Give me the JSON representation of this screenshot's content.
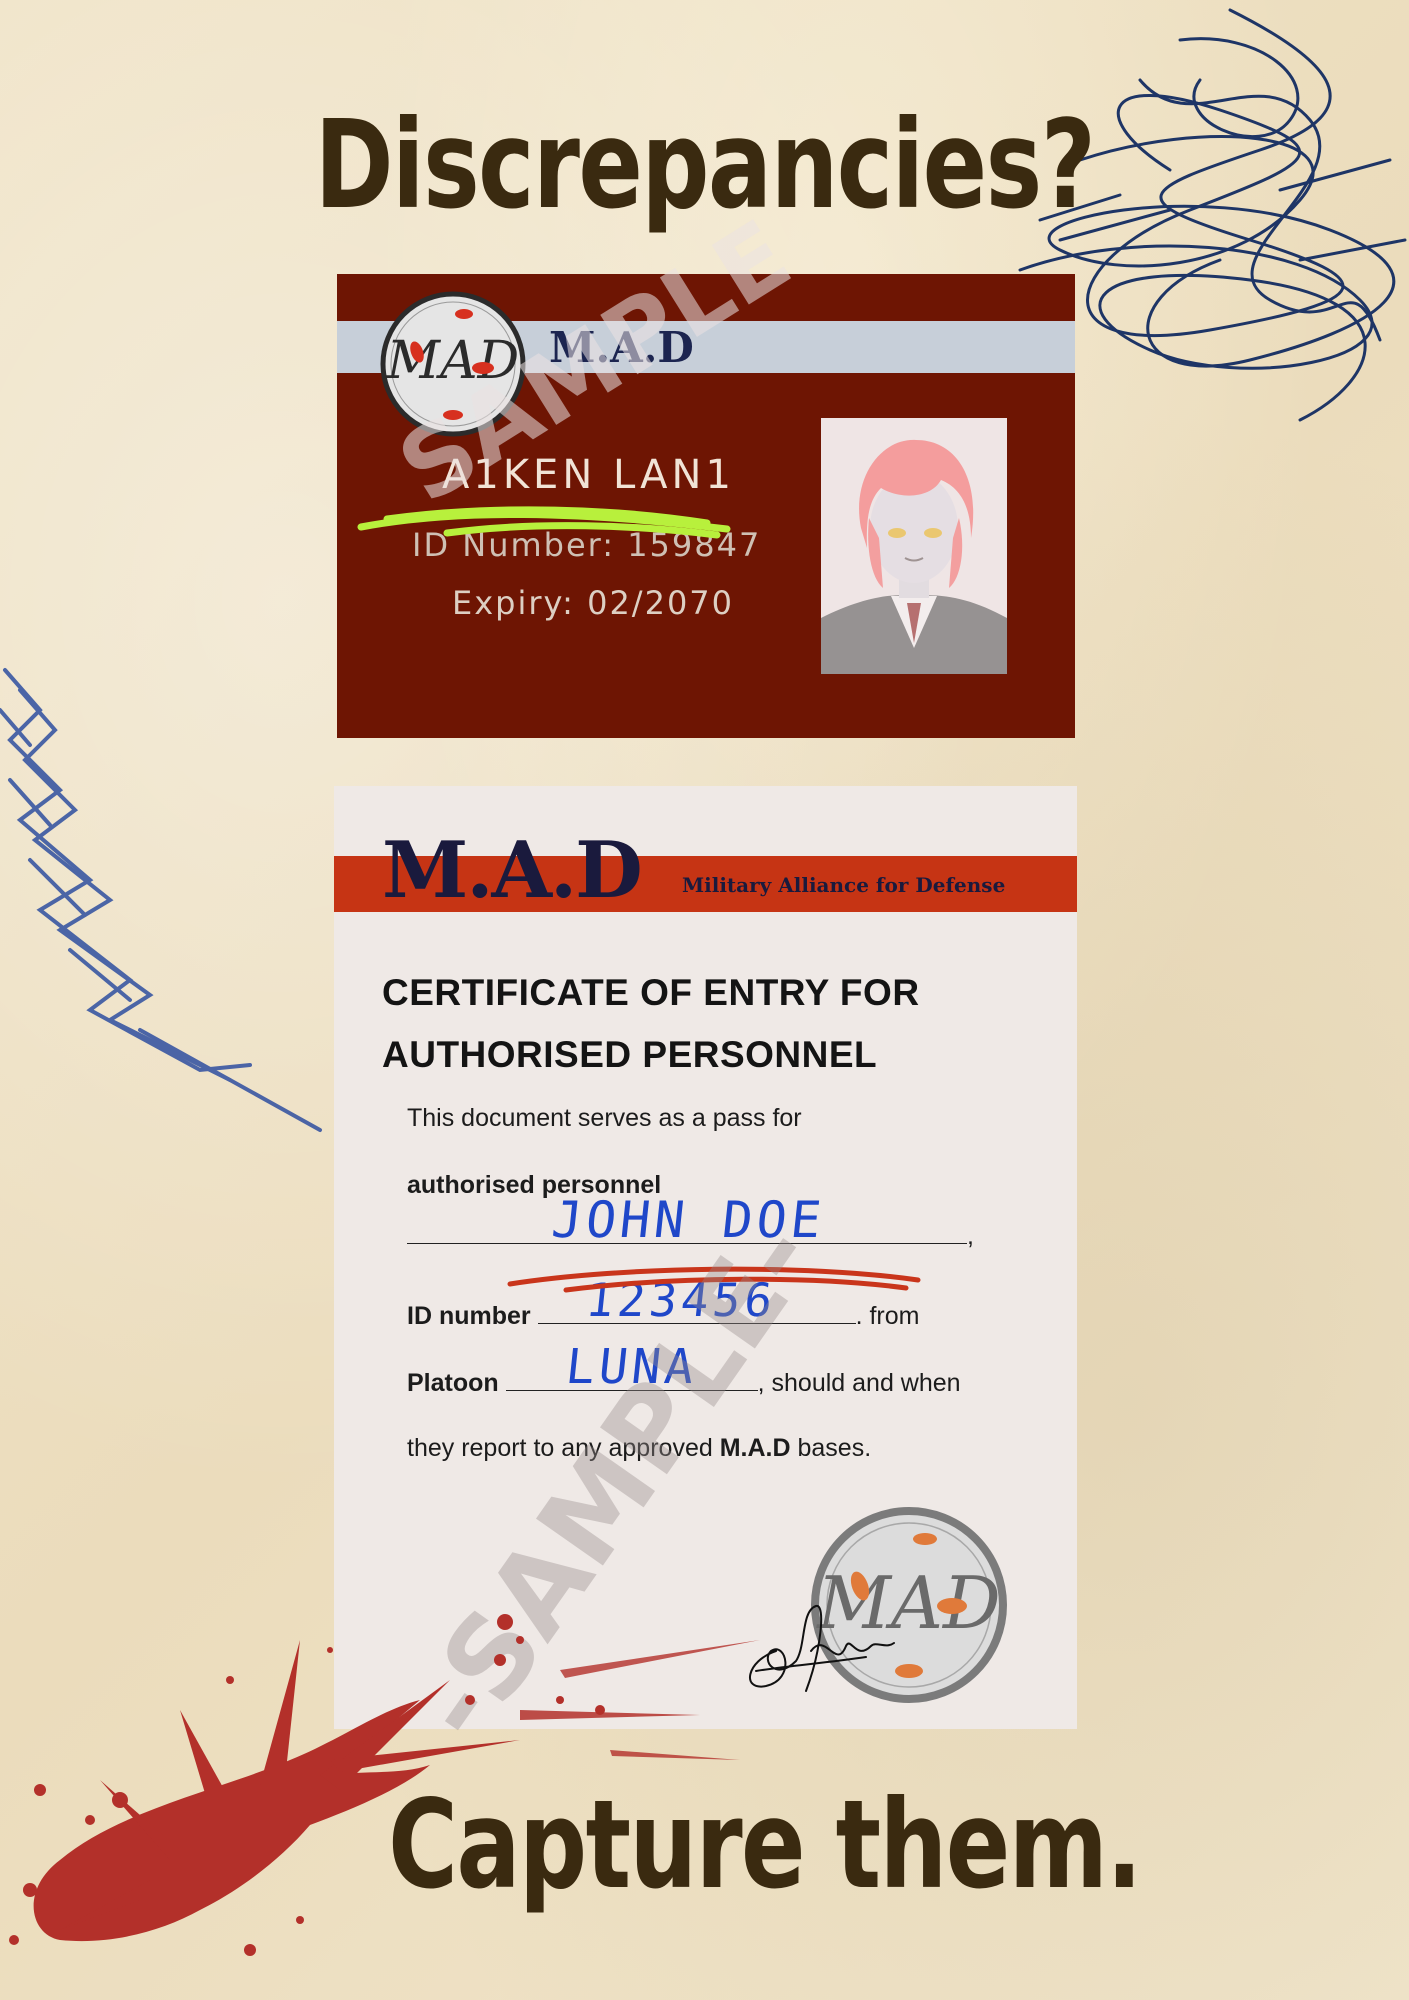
{
  "headline_top": "Discrepancies?",
  "headline_bottom": "Capture them.",
  "id_card": {
    "brand": "M.A.D",
    "name": "A1KEN LAN1",
    "id_number": "ID Number: 159847",
    "expiry": "Expiry:  02/2070",
    "watermark": "SAMPLE",
    "logo_text": "MAD"
  },
  "certificate": {
    "brand": "M.A.D",
    "brand_full": "Military Alliance for Defense",
    "title": "CERTIFICATE OF ENTRY FOR AUTHORISED PERSONNEL",
    "intro": "This document serves as a pass for",
    "authorised_label": "authorised personnel",
    "comma": ",",
    "id_label": "ID number",
    "from_text": ". from",
    "platoon_label": "Platoon",
    "should_text": ", should and when",
    "report_prefix": "they report to any approved ",
    "report_brand": "M.A.D",
    "report_suffix": " bases.",
    "handwritten_name": "JOHN DOE",
    "handwritten_id": "123456",
    "handwritten_platoon": "LUNA",
    "watermark": "-SAMPLE-",
    "seal_text": "MAD"
  },
  "colors": {
    "background": "#efe2c3",
    "headline": "#3a2a10",
    "id_card": "#6e1503",
    "id_band": "#c7cfd9",
    "certificate_bar": "#c63414",
    "ink_blue": "#1f47c9",
    "highlighter": "#b8f03c",
    "blood": "#b3302a",
    "scribble": "#1e3566"
  },
  "icons": [
    "mad-logo-icon",
    "seal-icon",
    "signature-icon",
    "blood-splatter-icon",
    "scribble-icon"
  ]
}
